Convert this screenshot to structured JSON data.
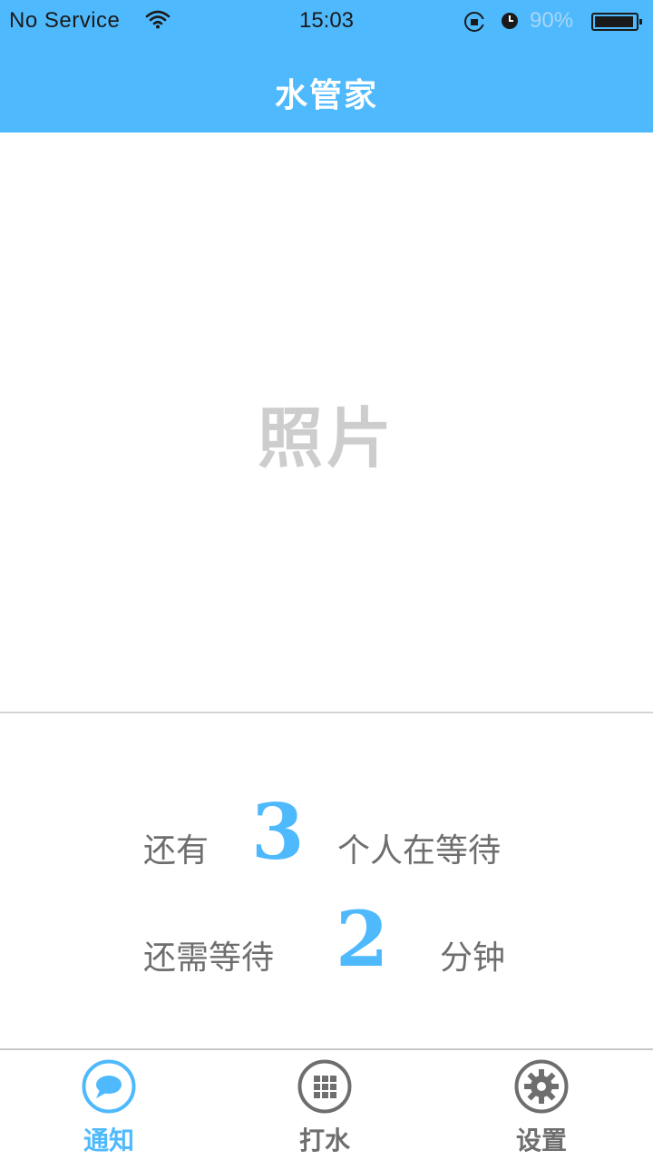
{
  "status_bar": {
    "carrier": "No Service",
    "time": "15:03",
    "battery_percent": "90%"
  },
  "header": {
    "title": "水管家"
  },
  "photo": {
    "placeholder": "照片"
  },
  "queue": {
    "people_prefix": "还有",
    "people_count": "3",
    "people_suffix": "个人在等待",
    "wait_prefix": "还需等待",
    "wait_minutes": "2",
    "wait_suffix": "分钟"
  },
  "tabs": [
    {
      "label": "通知",
      "icon": "chat-bubble-icon",
      "active": true
    },
    {
      "label": "打水",
      "icon": "grid-icon",
      "active": false
    },
    {
      "label": "设置",
      "icon": "gear-icon",
      "active": false
    }
  ],
  "colors": {
    "accent": "#4fb9fd",
    "inactive": "#6e6e6e",
    "placeholder": "#cdcdcd"
  }
}
